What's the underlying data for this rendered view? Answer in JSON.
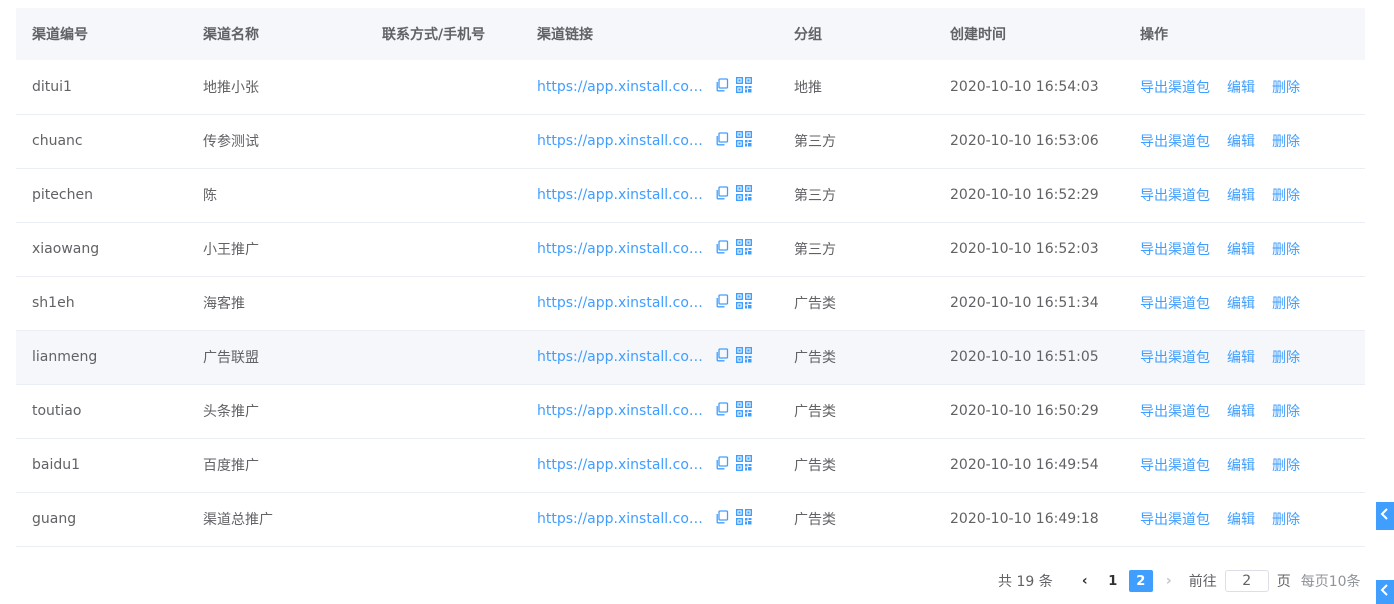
{
  "columns": [
    "渠道编号",
    "渠道名称",
    "联系方式/手机号",
    "渠道链接",
    "分组",
    "创建时间",
    "操作"
  ],
  "rows": [
    {
      "code": "ditui1",
      "name": "地推小张",
      "contact": "",
      "link": "https://app.xinstall.com/...",
      "group": "地推",
      "created": "2020-10-10 16:54:03"
    },
    {
      "code": "chuanc",
      "name": "传参测试",
      "contact": "",
      "link": "https://app.xinstall.com/...",
      "group": "第三方",
      "created": "2020-10-10 16:53:06"
    },
    {
      "code": "pitechen",
      "name": "陈",
      "contact": "",
      "link": "https://app.xinstall.com/...",
      "group": "第三方",
      "created": "2020-10-10 16:52:29"
    },
    {
      "code": "xiaowang",
      "name": "小王推广",
      "contact": "",
      "link": "https://app.xinstall.com/...",
      "group": "第三方",
      "created": "2020-10-10 16:52:03"
    },
    {
      "code": "sh1eh",
      "name": "海客推",
      "contact": "",
      "link": "https://app.xinstall.com/...",
      "group": "广告类",
      "created": "2020-10-10 16:51:34"
    },
    {
      "code": "lianmeng",
      "name": "广告联盟",
      "contact": "",
      "link": "https://app.xinstall.com/...",
      "group": "广告类",
      "created": "2020-10-10 16:51:05"
    },
    {
      "code": "toutiao",
      "name": "头条推广",
      "contact": "",
      "link": "https://app.xinstall.com/...",
      "group": "广告类",
      "created": "2020-10-10 16:50:29"
    },
    {
      "code": "baidu1",
      "name": "百度推广",
      "contact": "",
      "link": "https://app.xinstall.com/...",
      "group": "广告类",
      "created": "2020-10-10 16:49:54"
    },
    {
      "code": "guang",
      "name": "渠道总推广",
      "contact": "",
      "link": "https://app.xinstall.com/...",
      "group": "广告类",
      "created": "2020-10-10 16:49:18"
    }
  ],
  "actions": {
    "export": "导出渠道包",
    "edit": "编辑",
    "delete": "删除"
  },
  "icons": {
    "copy": "copy-icon",
    "qr": "qrcode-icon",
    "prev": "chevron-left-icon",
    "next": "chevron-right-icon",
    "side": "chevron-left-icon"
  },
  "pagination": {
    "total_text": "共 19 条",
    "pages": [
      "1",
      "2"
    ],
    "current_page": "2",
    "goto_label": "前往",
    "goto_value": "2",
    "page_unit": "页",
    "page_size": "每页10条"
  },
  "colors": {
    "accent": "#409eff",
    "text": "#606266",
    "header_bg": "#f5f7fa",
    "border": "#ebeef5"
  }
}
